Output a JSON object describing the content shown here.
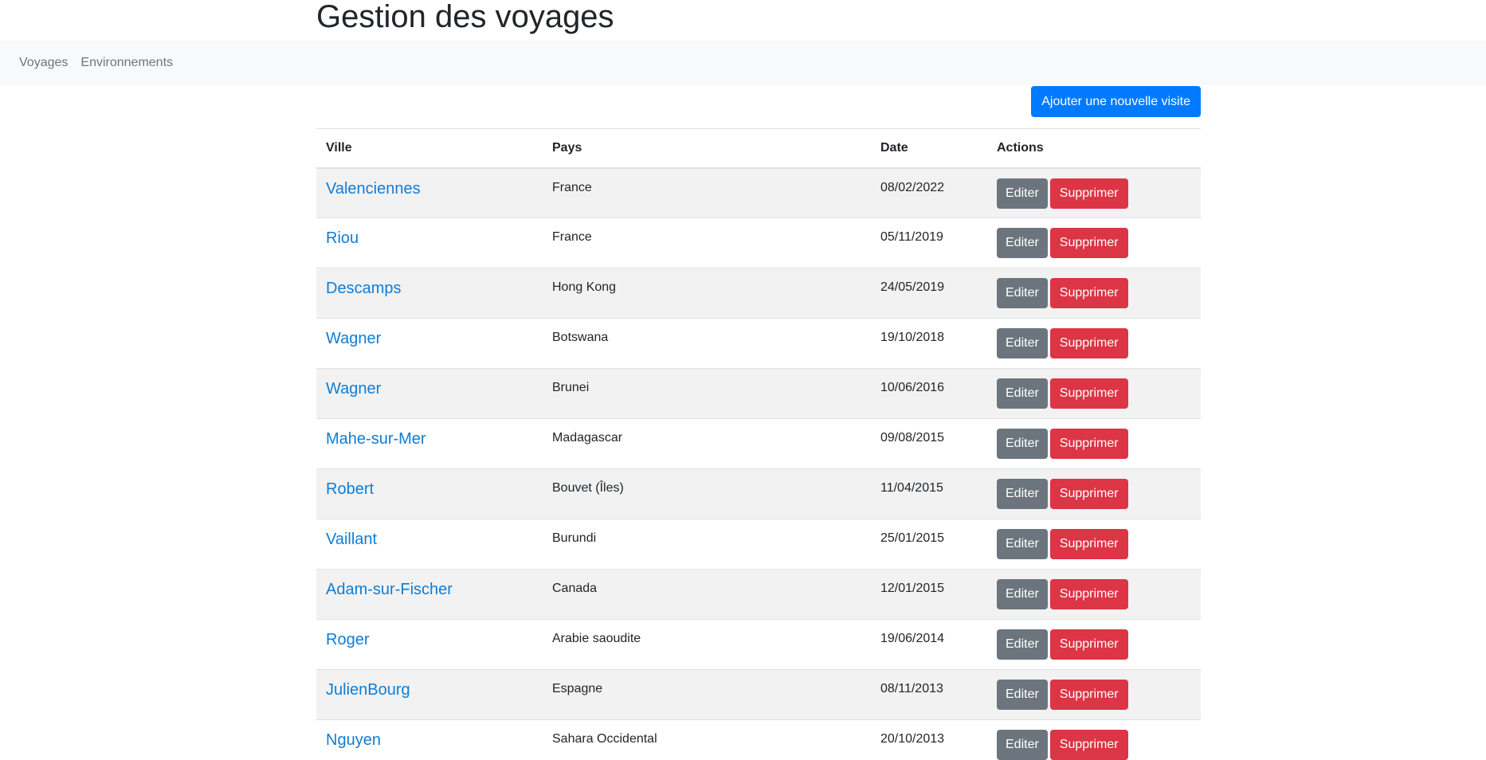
{
  "page": {
    "title": "Gestion des voyages"
  },
  "navbar": {
    "items": [
      {
        "label": "Voyages"
      },
      {
        "label": "Environnements"
      }
    ]
  },
  "toolbar": {
    "add_label": "Ajouter une nouvelle visite"
  },
  "table": {
    "headers": {
      "city": "Ville",
      "country": "Pays",
      "date": "Date",
      "actions": "Actions"
    },
    "edit_label": "Editer",
    "delete_label": "Supprimer",
    "rows": [
      {
        "city": "Valenciennes",
        "country": "France",
        "date": "08/02/2022"
      },
      {
        "city": "Riou",
        "country": "France",
        "date": "05/11/2019"
      },
      {
        "city": "Descamps",
        "country": "Hong Kong",
        "date": "24/05/2019"
      },
      {
        "city": "Wagner",
        "country": "Botswana",
        "date": "19/10/2018"
      },
      {
        "city": "Wagner",
        "country": "Brunei",
        "date": "10/06/2016"
      },
      {
        "city": "Mahe-sur-Mer",
        "country": "Madagascar",
        "date": "09/08/2015"
      },
      {
        "city": "Robert",
        "country": "Bouvet (Îles)",
        "date": "11/04/2015"
      },
      {
        "city": "Vaillant",
        "country": "Burundi",
        "date": "25/01/2015"
      },
      {
        "city": "Adam-sur-Fischer",
        "country": "Canada",
        "date": "12/01/2015"
      },
      {
        "city": "Roger",
        "country": "Arabie saoudite",
        "date": "19/06/2014"
      },
      {
        "city": "JulienBourg",
        "country": "Espagne",
        "date": "08/11/2013"
      },
      {
        "city": "Nguyen",
        "country": "Sahara Occidental",
        "date": "20/10/2013"
      }
    ]
  },
  "colors": {
    "primary": "#007bff",
    "secondary": "#6c757d",
    "danger": "#dc3545",
    "link": "#0f7dd6",
    "navbar_bg": "#f8f9fa",
    "stripe": "#f2f2f2"
  }
}
